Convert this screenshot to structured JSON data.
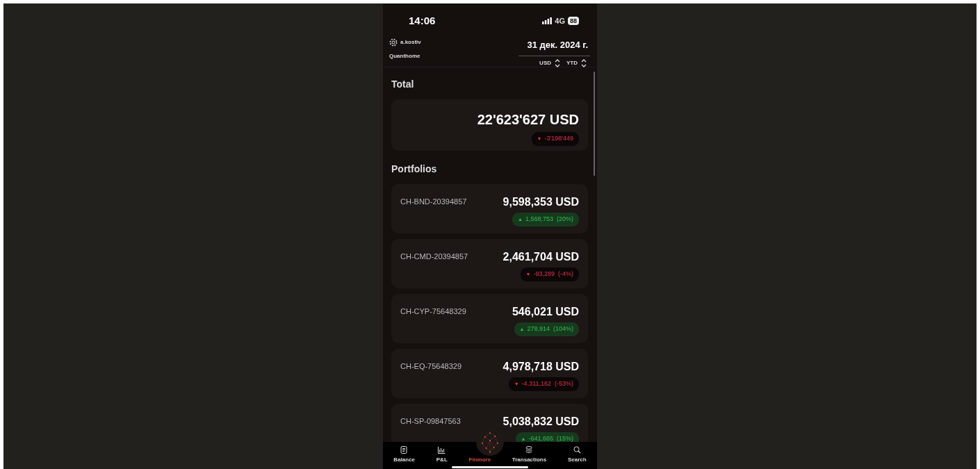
{
  "status_bar": {
    "time": "14:06",
    "network": "4G",
    "battery": "88"
  },
  "header": {
    "user": "a.kostiv",
    "company": "Quanthome",
    "date": "31 дек. 2024 г.",
    "currency": "USD",
    "period": "YTD"
  },
  "total": {
    "label": "Total",
    "value": "22'623'627 USD",
    "change": "-3'198'449",
    "arrow": "▼",
    "kind": "loss"
  },
  "portfolios_label": "Portfolios",
  "portfolios": [
    {
      "name": "CH-BND-20394857",
      "value": "9,598,353 USD",
      "change": "1,568,753",
      "percent": "(20%)",
      "arrow": "▲",
      "kind": "gain"
    },
    {
      "name": "CH-CMD-20394857",
      "value": "2,461,704 USD",
      "change": "-93,289",
      "percent": "(-4%)",
      "arrow": "▼",
      "kind": "loss"
    },
    {
      "name": "CH-CYP-75648329",
      "value": "546,021 USD",
      "change": "278,914",
      "percent": "(104%)",
      "arrow": "▲",
      "kind": "gain"
    },
    {
      "name": "CH-EQ-75648329",
      "value": "4,978,718 USD",
      "change": "-4,311,162",
      "percent": "(-53%)",
      "arrow": "▼",
      "kind": "loss"
    },
    {
      "name": "CH-SP-09847563",
      "value": "5,038,832 USD",
      "change": "-641,665",
      "percent": "(15%)",
      "arrow": "▲",
      "kind": "gain"
    }
  ],
  "tab_bar": [
    {
      "label": "Balance",
      "kind": "balance",
      "selected": false
    },
    {
      "label": "P&L",
      "kind": "pnl",
      "selected": false
    },
    {
      "label": "Finmore",
      "kind": "center",
      "selected": true
    },
    {
      "label": "Transactions",
      "kind": "transactions",
      "selected": false
    },
    {
      "label": "Search",
      "kind": "search",
      "selected": false
    }
  ]
}
